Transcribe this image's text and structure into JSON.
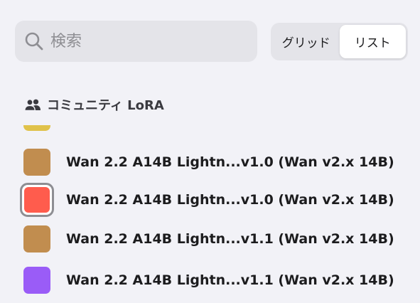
{
  "search": {
    "placeholder": "検索"
  },
  "view_toggle": {
    "options": [
      "グリッド",
      "リスト"
    ],
    "selected": "リスト"
  },
  "section": {
    "title": "コミュニティ LoRA",
    "icon": "people-icon"
  },
  "list": {
    "peek_color": "#e0c24a",
    "items": [
      {
        "label": "Wan 2.2 A14B Lightn...v1.0 (Wan v2.x 14B)",
        "color": "#c18d4f",
        "selected": false
      },
      {
        "label": "Wan 2.2 A14B Lightn...v1.0 (Wan v2.x 14B)",
        "color": "#ff5c4d",
        "selected": true
      },
      {
        "label": "Wan 2.2 A14B Lightn...v1.1 (Wan v2.x 14B)",
        "color": "#c18d4f",
        "selected": false
      },
      {
        "label": "Wan 2.2 A14B Lightn...v1.1 (Wan v2.x 14B)",
        "color": "#9a5cf7",
        "selected": false
      }
    ]
  }
}
